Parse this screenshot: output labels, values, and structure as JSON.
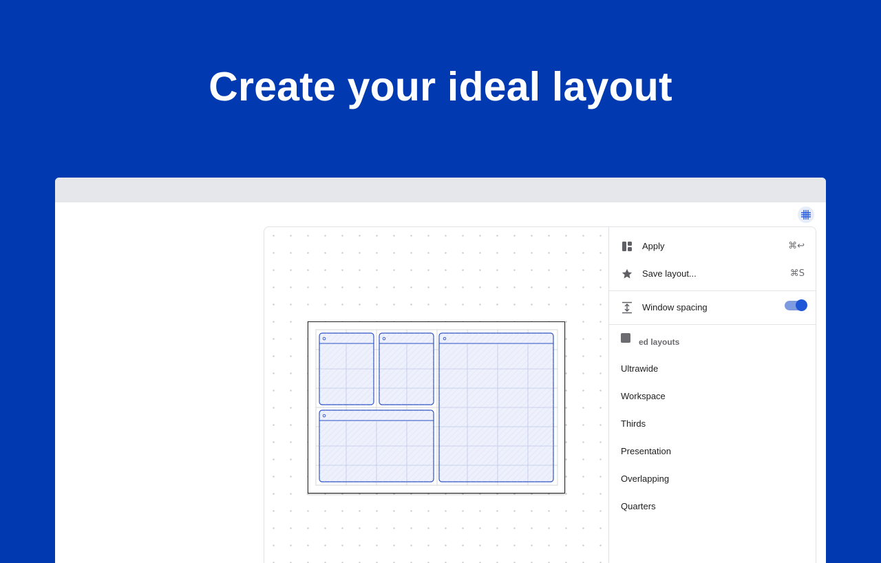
{
  "headline": "Create your ideal layout",
  "colors": {
    "background": "#0039b0",
    "accent": "#1f56d8",
    "window_outline": "#2a4fc4"
  },
  "toolbar": {
    "grid_toggle_icon": "grid-icon"
  },
  "menu": {
    "apply": {
      "label": "Apply",
      "shortcut": "⌘↩",
      "icon": "layout-icon"
    },
    "save": {
      "label": "Save layout...",
      "shortcut": "⌘S",
      "icon": "star-icon"
    },
    "spacing": {
      "label": "Window spacing",
      "icon": "vertical-spacing-icon",
      "enabled": true
    }
  },
  "saved_layouts": {
    "header_partial": "ed layouts",
    "header_visible_prefix": "",
    "icon": "window-icon",
    "items": [
      "Ultrawide",
      "Workspace",
      "Thirds",
      "Presentation",
      "Overlapping",
      "Quarters"
    ]
  }
}
